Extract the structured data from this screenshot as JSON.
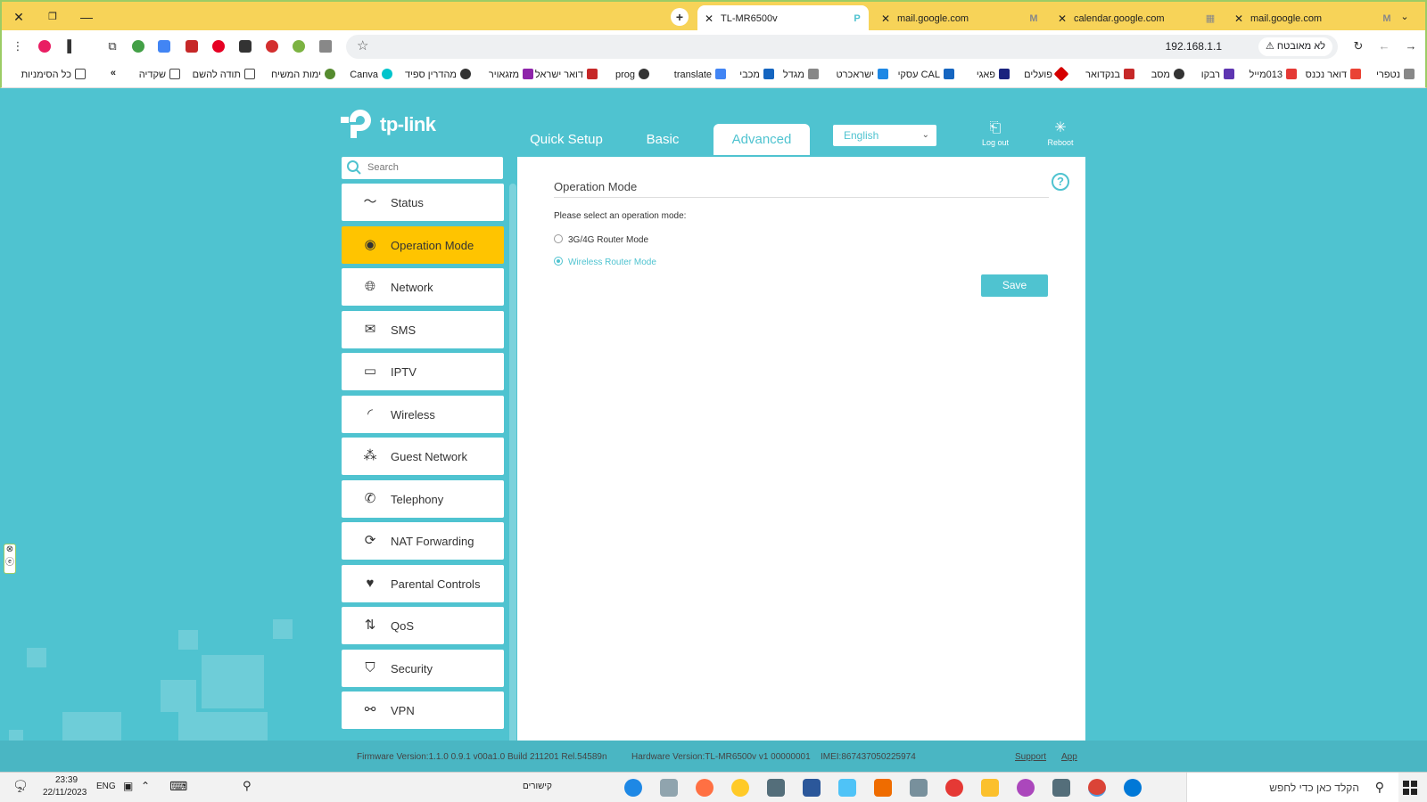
{
  "browser": {
    "tabs": [
      {
        "title": "TL-MR6500v",
        "active": true,
        "favicon": "tplink-icon"
      },
      {
        "title": "mail.google.com",
        "active": false,
        "favicon": "gmail-icon"
      },
      {
        "title": "calendar.google.com",
        "active": false,
        "favicon": "calendar-icon"
      },
      {
        "title": "mail.google.com",
        "active": false,
        "favicon": "gmail-icon"
      }
    ],
    "address": {
      "url": "192.168.1.1",
      "security_label": "לא מאובטח"
    },
    "bookmarks": [
      "נטפרי",
      "דואר נכנס",
      "013מייל",
      "רבקו",
      "מסב",
      "בנקדואר",
      "פועלים",
      "פאגי",
      "CAL עסקי",
      "ישראכרט",
      "מגדל",
      "מכבי",
      "translate",
      "prog",
      "דואר ישראל",
      "מזגאויר",
      "מהדרין ספיד",
      "Canva",
      "ימות המשיח",
      "תודה להשם",
      "שקדיה",
      "כל הסימניות"
    ]
  },
  "router": {
    "logo_text": "tp-link",
    "nav": {
      "quick_setup": "Quick Setup",
      "basic": "Basic",
      "advanced": "Advanced"
    },
    "language": "English",
    "logout_label": "Log out",
    "reboot_label": "Reboot",
    "search_placeholder": "Search",
    "sidebar": [
      {
        "label": "Status",
        "icon": "pulse-icon"
      },
      {
        "label": "Operation Mode",
        "icon": "toggle-icon",
        "active": true
      },
      {
        "label": "Network",
        "icon": "globe-icon"
      },
      {
        "label": "SMS",
        "icon": "envelope-icon"
      },
      {
        "label": "IPTV",
        "icon": "monitor-icon"
      },
      {
        "label": "Wireless",
        "icon": "wifi-icon"
      },
      {
        "label": "Guest Network",
        "icon": "guests-icon"
      },
      {
        "label": "Telephony",
        "icon": "phone-icon"
      },
      {
        "label": "NAT Forwarding",
        "icon": "refresh-icon"
      },
      {
        "label": "Parental Controls",
        "icon": "heart-icon"
      },
      {
        "label": "QoS",
        "icon": "updown-arrows-icon"
      },
      {
        "label": "Security",
        "icon": "shield-icon"
      },
      {
        "label": "VPN",
        "icon": "link-icon"
      }
    ],
    "content": {
      "title": "Operation Mode",
      "prompt": "Please select an operation mode:",
      "options": [
        {
          "label": "3G/4G Router Mode",
          "selected": false
        },
        {
          "label": "Wireless Router Mode",
          "selected": true
        }
      ],
      "save_label": "Save"
    },
    "footer": {
      "firmware": "Firmware Version:1.1.0 0.9.1 v00a1.0 Build 211201 Rel.54589n",
      "hardware": "Hardware Version:TL-MR6500v v1 00000001",
      "imei": "IMEI:867437050225974",
      "support": "Support",
      "app": "App"
    }
  },
  "taskbar": {
    "notification_count": "2",
    "time": "23:39",
    "date": "22/11/2023",
    "lang": "ENG",
    "links_label": "קישורים",
    "search_placeholder": "הקלד כאן כדי לחפש"
  },
  "colors": {
    "accent": "#4fc3d0",
    "active_item": "#ffc400",
    "tab_bar": "#f7d358"
  }
}
